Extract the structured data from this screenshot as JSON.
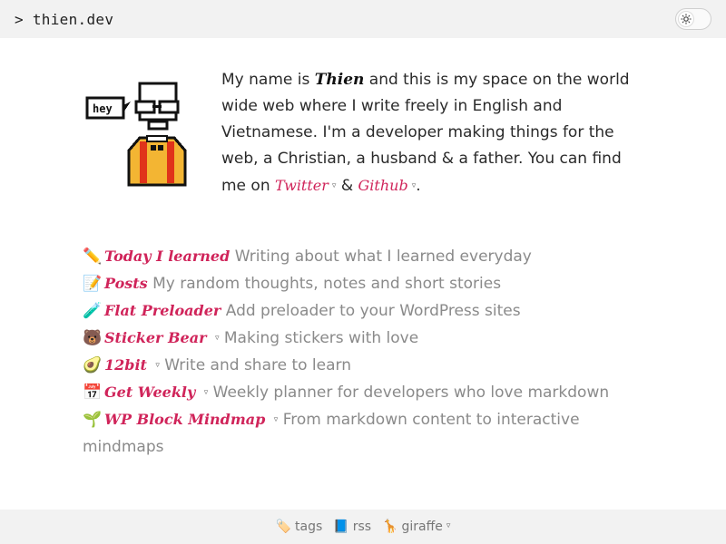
{
  "header": {
    "title": "> thien.dev",
    "theme_icon": "sun-icon"
  },
  "bio": {
    "p1": "My name is ",
    "name": "Thien",
    "p2": " and this is my space on the world wide web where I write freely in English and Vietnamese. I'm a developer making things for the web, a Christian, a husband & a father. You can find me on ",
    "twitter": "Twitter",
    "amp": " & ",
    "github": "Github",
    "end": ".",
    "bubble_text": "hey"
  },
  "projects": [
    {
      "emoji": "✏️",
      "name": "Today I learned",
      "desc": "Writing about what I learned everyday",
      "external": false
    },
    {
      "emoji": "📝",
      "name": "Posts",
      "desc": "My random thoughts, notes and short stories",
      "external": false
    },
    {
      "emoji": "🧪",
      "name": "Flat Preloader",
      "desc": "Add preloader to your WordPress sites",
      "external": false
    },
    {
      "emoji": "🐻",
      "name": "Sticker Bear",
      "desc": "Making stickers with love",
      "external": true
    },
    {
      "emoji": "🥑",
      "name": "12bit",
      "desc": "Write and share to learn",
      "external": true
    },
    {
      "emoji": "📅",
      "name": "Get Weekly",
      "desc": "Weekly planner for developers who love markdown",
      "external": true
    },
    {
      "emoji": "🌱",
      "name": "WP Block Mindmap",
      "desc": "From markdown content to interactive mindmaps",
      "external": true
    }
  ],
  "footer": {
    "tags": "tags",
    "tags_icon": "label-icon",
    "rss": "rss",
    "rss_icon": "book-icon",
    "giraffe": "giraffe",
    "giraffe_icon": "giraffe-icon"
  },
  "ext_marker": "▿"
}
